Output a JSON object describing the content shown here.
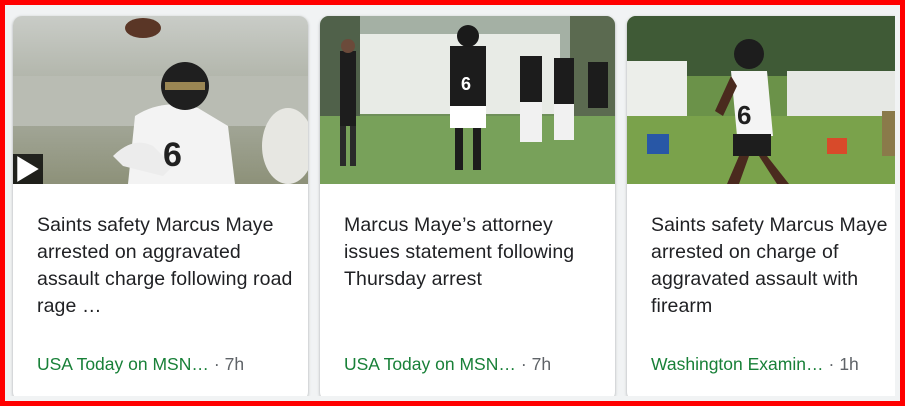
{
  "cards": [
    {
      "headline": "Saints safety Marcus Maye arrested on aggravated assault charge following road rage …",
      "source": "USA Today on MSN…",
      "separator": "·",
      "time": "7h",
      "has_video": true,
      "video_icon": "play-icon",
      "jersey": "6"
    },
    {
      "headline": "Marcus Maye’s attorney issues statement following Thursday arrest",
      "source": "USA Today on MSN…",
      "separator": "·",
      "time": "7h",
      "has_video": false,
      "jersey": "6"
    },
    {
      "headline": "Saints safety Marcus Maye arrested on charge of aggravated assault with firearm",
      "source": "Washington Examin…",
      "separator": "·",
      "time": "1h",
      "has_video": false,
      "jersey": "6"
    }
  ],
  "colors": {
    "source_green": "#188038",
    "meta_gray": "#5f6368",
    "headline": "#202124",
    "frame": "#ff0000"
  }
}
